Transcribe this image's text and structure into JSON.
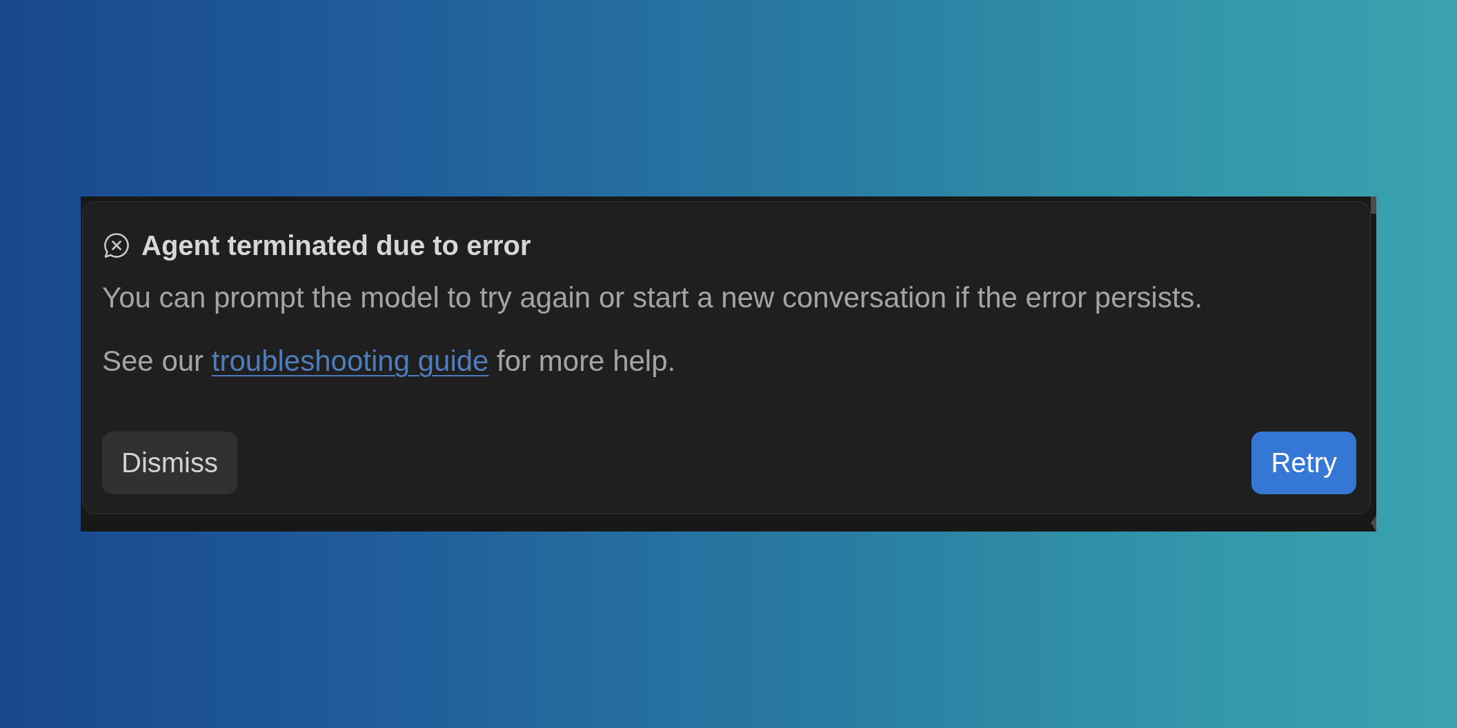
{
  "notification": {
    "title": "Agent terminated due to error",
    "message": "You can prompt the model to try again or start a new conversation if the error persists.",
    "help": {
      "before": "See our ",
      "link": "troubleshooting guide",
      "after": " for more help."
    }
  },
  "actions": [
    {
      "label": "Dismiss",
      "kind": "secondary"
    },
    {
      "label": "Retry",
      "kind": "primary"
    }
  ]
}
